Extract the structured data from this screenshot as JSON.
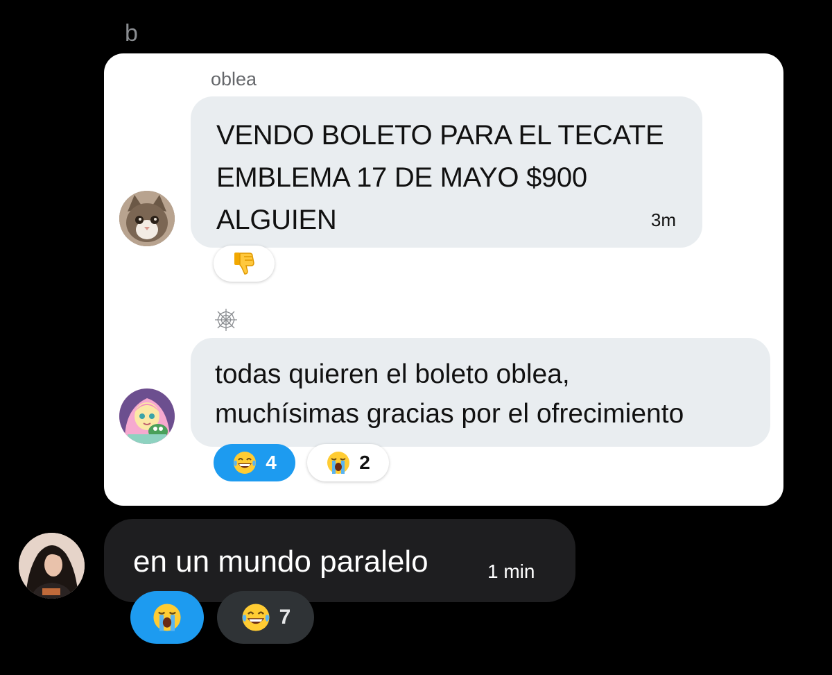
{
  "header": {
    "sender_label": "b"
  },
  "quoted_chat": {
    "sender_name": "oblea",
    "messages": [
      {
        "text": "VENDO BOLETO PARA EL TECATE\nEMBLEMA 17 DE MAYO $900\nALGUIEN",
        "time": "3m",
        "reactions": [
          {
            "icon": "thumbs-down-icon",
            "count": ""
          }
        ]
      },
      {
        "text": "todas quieren el boleto oblea,\nmuchísimas gracias por el ofrecimiento",
        "reactions": [
          {
            "icon": "laughing-tears-icon",
            "count": "4",
            "selected": true
          },
          {
            "icon": "crying-face-icon",
            "count": "2",
            "selected": false
          }
        ]
      }
    ]
  },
  "reply": {
    "text": "en un mundo paralelo",
    "time": "1 min",
    "reactions": [
      {
        "icon": "crying-face-icon",
        "count": "",
        "selected": true
      },
      {
        "icon": "laughing-tears-icon",
        "count": "7",
        "selected": false
      }
    ]
  },
  "colors": {
    "background": "#000000",
    "card": "#ffffff",
    "bubble_light": "#e9edf0",
    "bubble_dark": "#1e1e20",
    "accent_blue": "#1d9bf0"
  }
}
